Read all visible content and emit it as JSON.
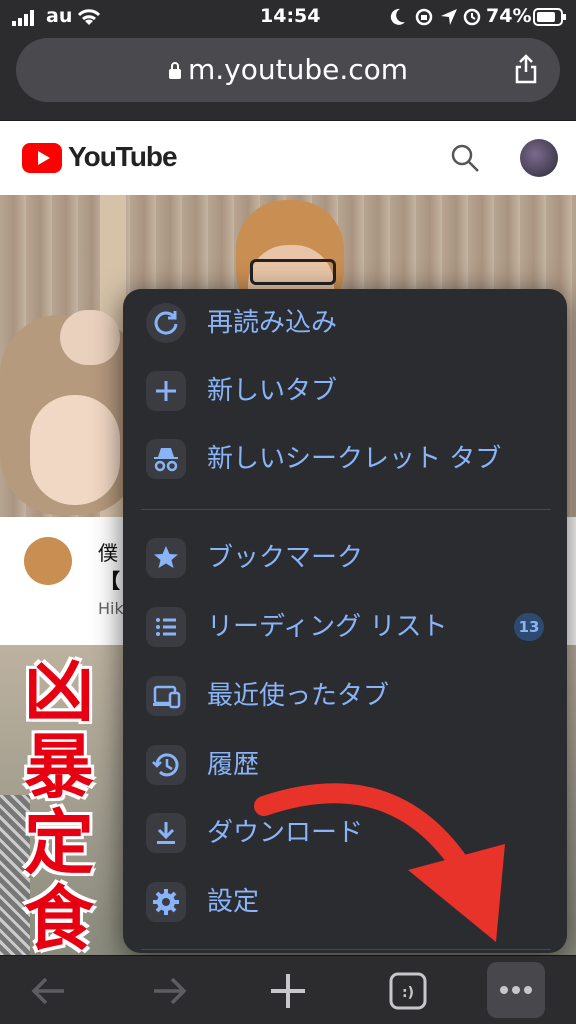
{
  "status": {
    "carrier": "au",
    "time": "14:54",
    "battery": "74%"
  },
  "url": "m.youtube.com",
  "youtube": {
    "logo_text": "YouTube"
  },
  "video": {
    "title_partial": "僕",
    "subtitle_partial": "【",
    "channel_partial": "Hik",
    "thumb_text": [
      "凶",
      "暴",
      "定",
      "食"
    ]
  },
  "menu": {
    "items": [
      {
        "label": "再読み込み",
        "icon": "reload-icon"
      },
      {
        "label": "新しいタブ",
        "icon": "plus-icon"
      },
      {
        "label": "新しいシークレット タブ",
        "icon": "incognito-icon"
      },
      {
        "label": "ブックマーク",
        "icon": "star-icon"
      },
      {
        "label": "リーディング リスト",
        "icon": "list-icon",
        "badge": "13"
      },
      {
        "label": "最近使ったタブ",
        "icon": "devices-icon"
      },
      {
        "label": "履歴",
        "icon": "history-icon"
      },
      {
        "label": "ダウンロード",
        "icon": "download-icon"
      },
      {
        "label": "設定",
        "icon": "gear-icon"
      }
    ]
  },
  "colors": {
    "menu_text": "#8ab4f8",
    "menu_bg": "#2b2c2f",
    "arrow": "#e8332a",
    "yt_red": "#ff0000"
  }
}
